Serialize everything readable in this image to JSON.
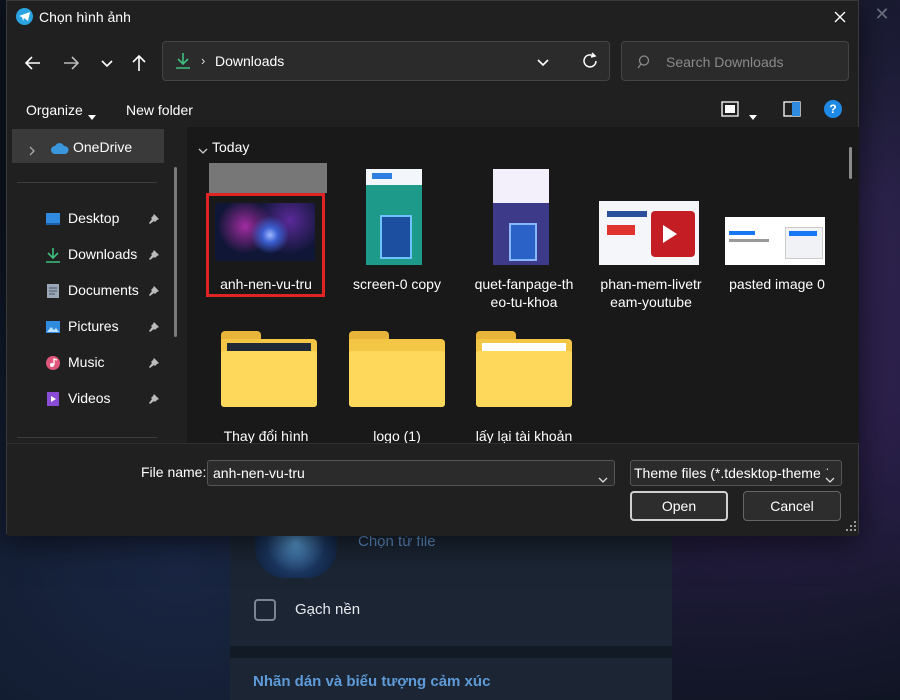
{
  "background_app": {
    "choose_from_file": "Chọn từ file",
    "background_option": "Gạch nền",
    "stickers_section": "Nhãn dán và biểu tượng cảm xúc"
  },
  "dialog": {
    "title": "Chọn hình ảnh",
    "address": {
      "path": "Downloads"
    },
    "search": {
      "placeholder": "Search Downloads"
    },
    "commands": {
      "organize": "Organize",
      "new_folder": "New folder"
    },
    "sidebar": {
      "onedrive": "OneDrive",
      "items": [
        {
          "label": "Desktop",
          "icon": "desktop-icon"
        },
        {
          "label": "Downloads",
          "icon": "download-icon"
        },
        {
          "label": "Documents",
          "icon": "document-icon"
        },
        {
          "label": "Pictures",
          "icon": "pictures-icon"
        },
        {
          "label": "Music",
          "icon": "music-icon"
        },
        {
          "label": "Videos",
          "icon": "videos-icon"
        }
      ]
    },
    "group_label": "Today",
    "files": [
      {
        "name": "anh-nen-vu-tru",
        "kind": "image",
        "selected": true
      },
      {
        "name": "screen-0 copy",
        "kind": "image"
      },
      {
        "name": "quet-fanpage-theo-tu-khoa",
        "line1": "quet-fanpage-th",
        "line2": "eo-tu-khoa",
        "kind": "image"
      },
      {
        "name": "phan-mem-livetream-youtube",
        "line1": "phan-mem-livetr",
        "line2": "eam-youtube",
        "kind": "image"
      },
      {
        "name": "pasted image 0",
        "kind": "image"
      },
      {
        "name": "Thay đổi hình",
        "kind": "folder"
      },
      {
        "name": "logo (1)",
        "kind": "folder"
      },
      {
        "name": "lấy lại tài khoản",
        "kind": "folder"
      }
    ],
    "footer": {
      "file_name_label": "File name:",
      "file_name_value": "anh-nen-vu-tru",
      "file_type": "Theme files (*.tdesktop-theme *",
      "open": "Open",
      "cancel": "Cancel"
    }
  },
  "colors": {
    "dialog_bg": "#202020",
    "content_bg": "#191919",
    "selection_outline": "#e02424",
    "accent_blue": "#1f8ae6",
    "folder_yellow": "#fdd85a"
  }
}
